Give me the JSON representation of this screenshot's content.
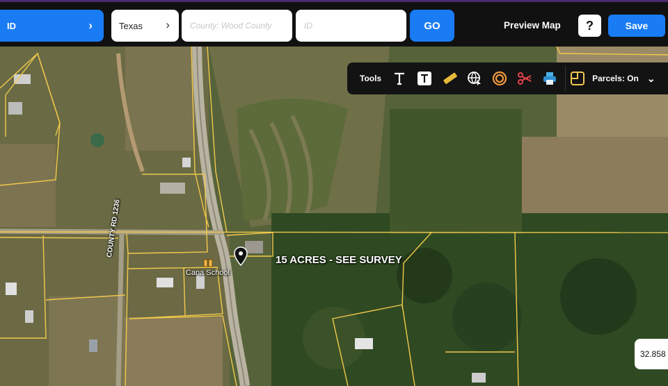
{
  "topbar": {
    "type_select_label": "ID",
    "state_select_label": "Texas",
    "county_placeholder": "County: Wood County",
    "id_placeholder": "ID",
    "go_label": "GO",
    "preview_label": "Preview Map",
    "help_label": "?",
    "save_label": "Save"
  },
  "tools": {
    "label": "Tools",
    "items": [
      "text-icon",
      "text-box-icon",
      "ruler-icon",
      "globe-cursor-icon",
      "radius-icon",
      "cut-icon",
      "print-icon"
    ],
    "parcels_label": "Parcels: On"
  },
  "map": {
    "acres_label": "15 ACRES - SEE SURVEY",
    "school_label": "Cana School",
    "road_label": "COUNTY RD 1236",
    "coordinate": "32.858",
    "colors": {
      "parcel_line": "#f2c94c",
      "accent": "#1a7cf5"
    }
  }
}
